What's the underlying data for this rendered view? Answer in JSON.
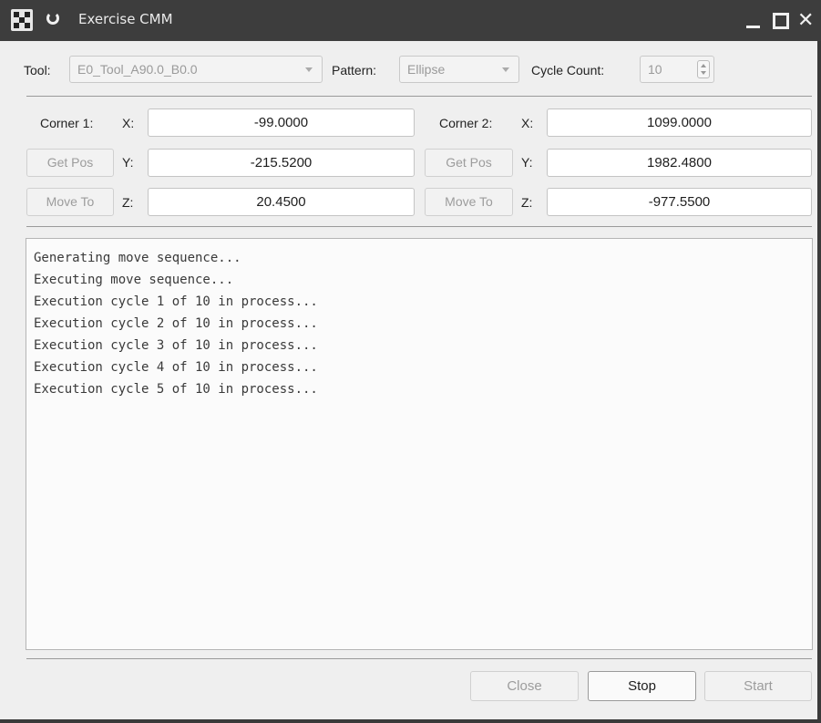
{
  "window": {
    "title": "Exercise CMM"
  },
  "toolbar": {
    "tool_label": "Tool:",
    "tool_value": "E0_Tool_A90.0_B0.0",
    "pattern_label": "Pattern:",
    "pattern_value": "Ellipse",
    "cycle_label": "Cycle Count:",
    "cycle_value": "10"
  },
  "corner1": {
    "label": "Corner 1:",
    "x_label": "X:",
    "x_value": "-99.0000",
    "y_label": "Y:",
    "y_value": "-215.5200",
    "z_label": "Z:",
    "z_value": "20.4500",
    "get_pos_label": "Get Pos",
    "move_to_label": "Move To"
  },
  "corner2": {
    "label": "Corner 2:",
    "x_label": "X:",
    "x_value": "1099.0000",
    "y_label": "Y:",
    "y_value": "1982.4800",
    "z_label": "Z:",
    "z_value": "-977.5500",
    "get_pos_label": "Get Pos",
    "move_to_label": "Move To"
  },
  "log": {
    "lines": [
      "Generating move sequence...",
      "Executing move sequence...",
      "Execution cycle 1 of 10 in process...",
      "Execution cycle 2 of 10 in process...",
      "Execution cycle 3 of 10 in process...",
      "Execution cycle 4 of 10 in process...",
      "Execution cycle 5 of 10 in process..."
    ]
  },
  "buttons": {
    "close": "Close",
    "stop": "Stop",
    "start": "Start"
  },
  "icons": {
    "app": "app-icon",
    "refresh": "refresh-icon",
    "minimize": "minimize-icon",
    "maximize": "maximize-icon",
    "close": "close-icon"
  }
}
